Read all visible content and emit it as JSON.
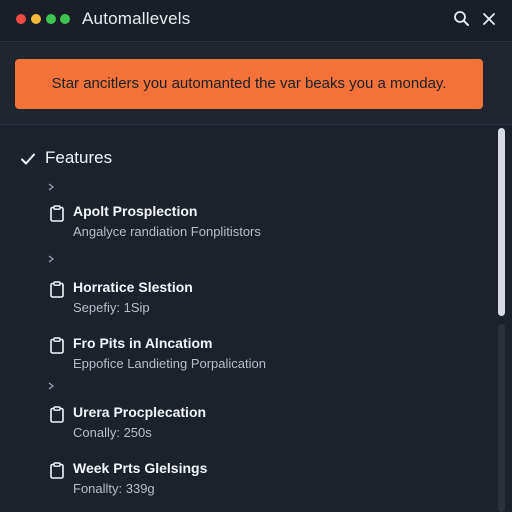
{
  "window": {
    "title": "Automallevels"
  },
  "banner": {
    "text": "Star ancitlers you automanted the var beaks you a monday."
  },
  "section": {
    "title": "Features"
  },
  "items": [
    {
      "title": "Apolt Prosplection",
      "subtitle": "Angalyce randiation Fonplitistors"
    },
    {
      "title": "Horratice Slestion",
      "subtitle": "Sepefiy: 1Sip"
    },
    {
      "title": "Fro Pits in Alncatiom",
      "subtitle": "Eppofice Landieting Porpalication"
    },
    {
      "title": "Urera Procplecation",
      "subtitle": "Conally: 250s"
    },
    {
      "title": "Week Prts Glelsings",
      "subtitle": "Fonallty: 339g"
    }
  ],
  "colors": {
    "banner": "#f5733a",
    "background": "#1b222c",
    "titlebar": "#1a1f27"
  },
  "icons": {
    "search": "search-icon",
    "close": "close-icon",
    "check": "check-icon",
    "item": "clipboard-icon",
    "expand": "chevron-right-icon"
  }
}
